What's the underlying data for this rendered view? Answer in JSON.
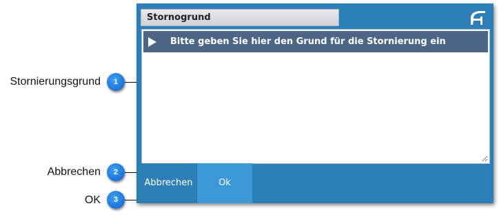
{
  "dialog": {
    "title": "Stornogrund",
    "logo_icon": "brand-logo-icon",
    "prompt": "Bitte geben Sie hier den Grund für die Stornierung ein",
    "reason_value": "",
    "buttons": {
      "cancel": "Abbrechen",
      "ok": "Ok"
    },
    "colors": {
      "frame": "#2e7fb8",
      "prompt_bar": "#4d6686",
      "ok_button": "#3c97d6",
      "badge": "#1a78e6"
    }
  },
  "callouts": [
    {
      "number": "1",
      "label": "Stornierungsgrund"
    },
    {
      "number": "2",
      "label": "Abbrechen"
    },
    {
      "number": "3",
      "label": "OK"
    }
  ]
}
